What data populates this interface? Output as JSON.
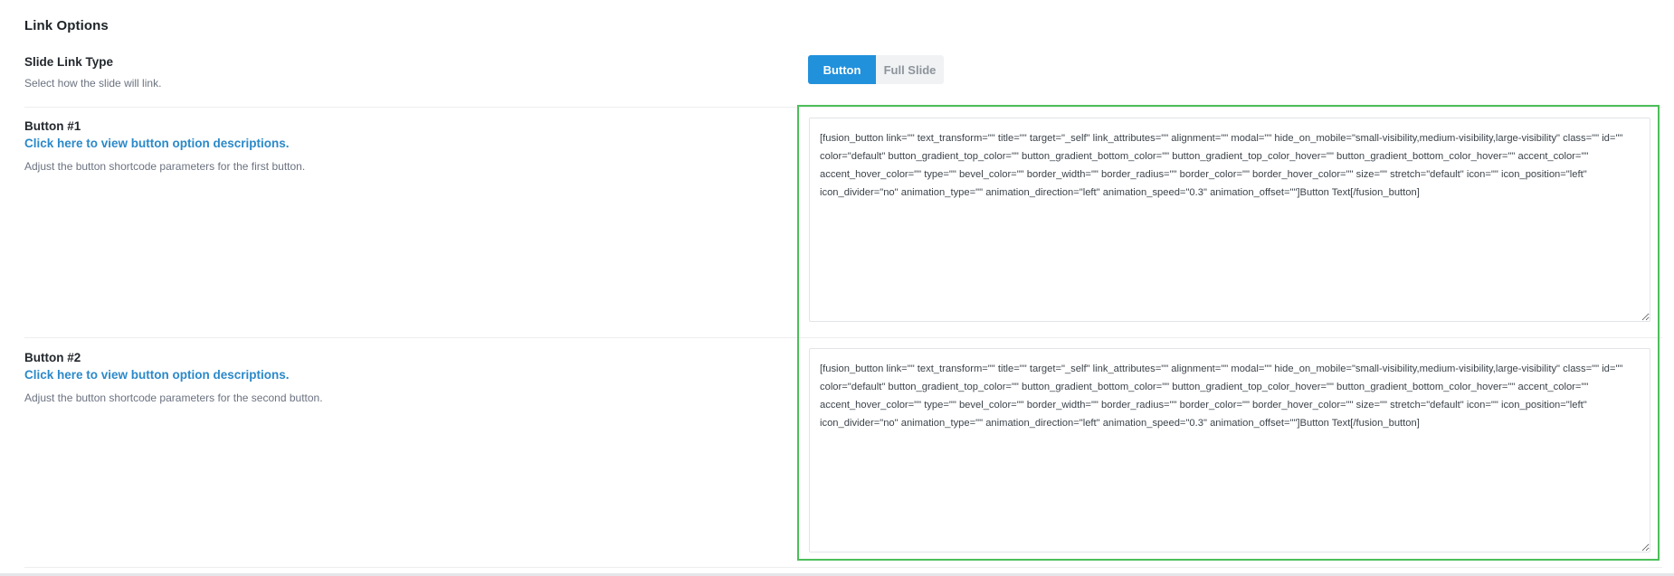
{
  "section": {
    "title": "Link Options"
  },
  "slide_link_type": {
    "label": "Slide Link Type",
    "description": "Select how the slide will link.",
    "options": [
      "Button",
      "Full Slide"
    ],
    "selected": "Button"
  },
  "button1": {
    "label": "Button #1",
    "link_text": "Click here to view button option descriptions.",
    "description": "Adjust the button shortcode parameters for the first button.",
    "value": "[fusion_button link=\"\" text_transform=\"\" title=\"\" target=\"_self\" link_attributes=\"\" alignment=\"\" modal=\"\" hide_on_mobile=\"small-visibility,medium-visibility,large-visibility\" class=\"\" id=\"\" color=\"default\" button_gradient_top_color=\"\" button_gradient_bottom_color=\"\" button_gradient_top_color_hover=\"\" button_gradient_bottom_color_hover=\"\" accent_color=\"\" accent_hover_color=\"\" type=\"\" bevel_color=\"\" border_width=\"\" border_radius=\"\" border_color=\"\" border_hover_color=\"\" size=\"\" stretch=\"default\" icon=\"\" icon_position=\"left\" icon_divider=\"no\" animation_type=\"\" animation_direction=\"left\" animation_speed=\"0.3\" animation_offset=\"\"]Button Text[/fusion_button]"
  },
  "button2": {
    "label": "Button #2",
    "link_text": "Click here to view button option descriptions.",
    "description": "Adjust the button shortcode parameters for the second button.",
    "value": "[fusion_button link=\"\" text_transform=\"\" title=\"\" target=\"_self\" link_attributes=\"\" alignment=\"\" modal=\"\" hide_on_mobile=\"small-visibility,medium-visibility,large-visibility\" class=\"\" id=\"\" color=\"default\" button_gradient_top_color=\"\" button_gradient_bottom_color=\"\" button_gradient_top_color_hover=\"\" button_gradient_bottom_color_hover=\"\" accent_color=\"\" accent_hover_color=\"\" type=\"\" bevel_color=\"\" border_width=\"\" border_radius=\"\" border_color=\"\" border_hover_color=\"\" size=\"\" stretch=\"default\" icon=\"\" icon_position=\"left\" icon_divider=\"no\" animation_type=\"\" animation_direction=\"left\" animation_speed=\"0.3\" animation_offset=\"\"]Button Text[/fusion_button]"
  },
  "colors": {
    "accent": "#2191dc",
    "link": "#2b89c9",
    "highlight_frame": "#4cbf5a"
  }
}
